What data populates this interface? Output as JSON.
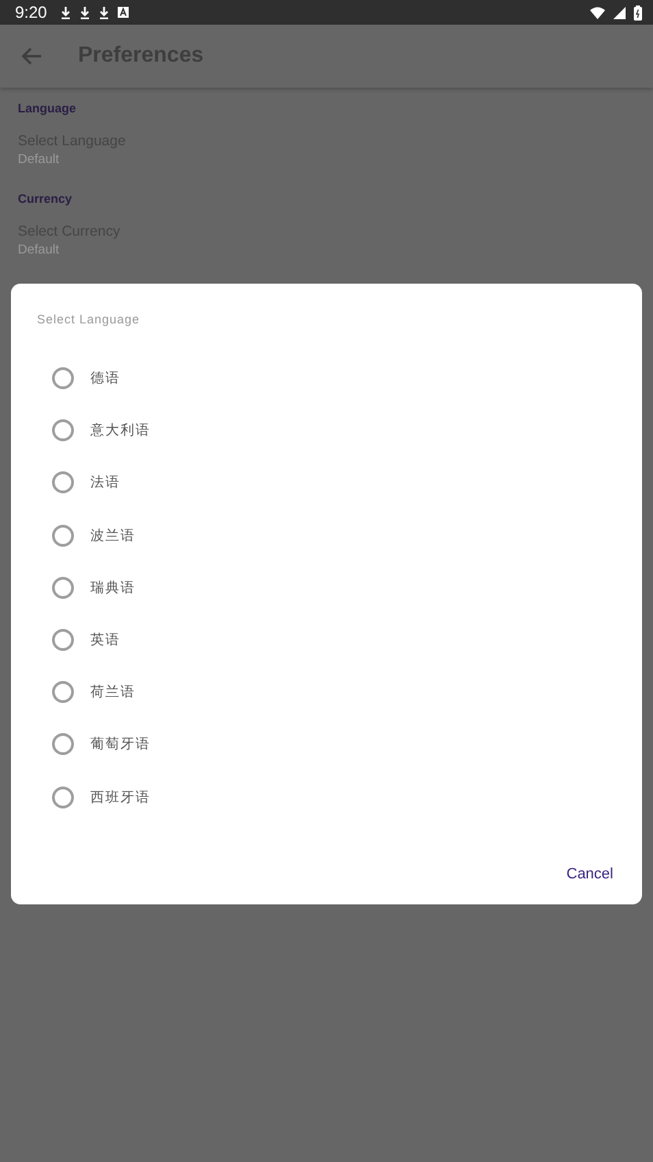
{
  "status_bar": {
    "time": "9:20"
  },
  "app_bar": {
    "title": "Preferences"
  },
  "sections": [
    {
      "header": "Language",
      "title": "Select Language",
      "summary": "Default"
    },
    {
      "header": "Currency",
      "title": "Select Currency",
      "summary": "Default"
    }
  ],
  "dialog": {
    "title": "Select Language",
    "options": [
      {
        "label": "德语",
        "selected": false
      },
      {
        "label": "意大利语",
        "selected": false
      },
      {
        "label": "法语",
        "selected": false
      },
      {
        "label": "波兰语",
        "selected": false
      },
      {
        "label": "瑞典语",
        "selected": false
      },
      {
        "label": "英语",
        "selected": false
      },
      {
        "label": "荷兰语",
        "selected": false
      },
      {
        "label": "葡萄牙语",
        "selected": false
      },
      {
        "label": "西班牙语",
        "selected": false
      }
    ],
    "buttons": [
      "Cancel"
    ]
  }
}
